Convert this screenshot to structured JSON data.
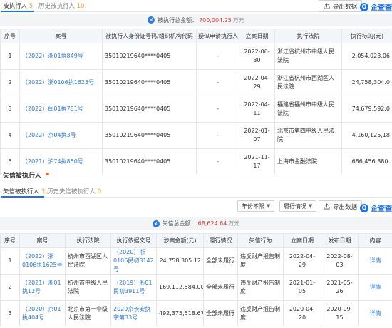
{
  "top_tabs": [
    {
      "label": "被执行人",
      "count": "5"
    },
    {
      "label": "历史被执行人",
      "count": "10"
    }
  ],
  "export_label": "导出数据",
  "logo_text": "企查查",
  "summary1": {
    "label": "被执行总金额：",
    "amount": "700,004.25",
    "unit": "万元"
  },
  "table1": {
    "headers": [
      "序号",
      "案号",
      "被执行人身份证号码/组织机构代码",
      "疑似申请执行人",
      "立案日期",
      "执行法院",
      "执行标的(元)"
    ],
    "rows": [
      {
        "idx": "1",
        "case": "（2022）浙01执849号",
        "id": "35010219640****0405",
        "applicant": "-",
        "date": "2022-06-30",
        "court": "浙江省杭州市中级人民法院",
        "amount": "2,054,023,06"
      },
      {
        "idx": "2",
        "case": "（2022）浙0106执1625号",
        "id": "35010219640****0405",
        "applicant": "-",
        "date": "2022-04-29",
        "court": "浙江省杭州市西湖区人民法院",
        "amount": "24,758,304.0"
      },
      {
        "idx": "3",
        "case": "（2022）闽01执781号",
        "id": "35010219640****0405",
        "applicant": "-",
        "date": "2022-04-11",
        "court": "福建省福州市中级人民法院",
        "amount": "74,679,592.0"
      },
      {
        "idx": "4",
        "case": "（2022）京04执3号",
        "id": "35010219640****0405",
        "applicant": "-",
        "date": "2022-01-07",
        "court": "北京市第四中级人民法院",
        "amount": "4,160,125,18"
      },
      {
        "idx": "5",
        "case": "（2021）沪74执850号",
        "id": "35010219640****0405",
        "applicant": "-",
        "date": "2021-11-17",
        "court": "上海市金融法院",
        "amount": "686,456,380."
      }
    ]
  },
  "section2": {
    "title": "失信被执行人"
  },
  "bottom_tabs": [
    {
      "label": "失信被执行人",
      "count": "3"
    },
    {
      "label": "历史失信被执行人",
      "count": "0"
    }
  ],
  "filters": {
    "year": "年份不限",
    "status": "履行情况"
  },
  "summary2": {
    "label": "失信总金额：",
    "amount": "68,624.64",
    "unit": "万元"
  },
  "table2": {
    "headers": [
      "序号",
      "案号",
      "执行法院",
      "执行依据文号",
      "涉案金额(元)",
      "履行情况",
      "失信行为",
      "立案日期",
      "发布日期",
      "内容"
    ],
    "rows": [
      {
        "idx": "1",
        "case": "（2022）浙0106执1625号",
        "court": "杭州市西湖区人民法院",
        "basis": "（2020）浙0106民初3142号",
        "amount": "24,758,305.12",
        "status": "全部未履行",
        "behavior": "违反财产报告制度",
        "date": "2022-04-29",
        "pub": "2022-08-03",
        "action": "详情"
      },
      {
        "idx": "2",
        "case": "（2021）浙01执12号",
        "court": "杭州市中级人民法院",
        "basis": "（2019）浙01民初3911号",
        "amount": "169,112,584.00",
        "status": "全部未履行",
        "behavior": "违反财产报告制度",
        "date": "2021-01-05",
        "pub": "2021-05-26",
        "action": "详情"
      },
      {
        "idx": "3",
        "case": "（2020）京01执404号",
        "court": "北京市第一中级人民法院",
        "basis": "2020京长安执字第33号",
        "amount": "492,375,518.67",
        "status": "全部未履行",
        "behavior": "违反财产报告制度",
        "date": "2020-04-20",
        "pub": "2020-09-15",
        "action": "详情"
      }
    ]
  }
}
